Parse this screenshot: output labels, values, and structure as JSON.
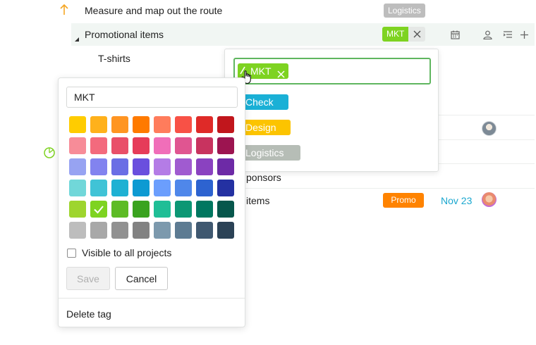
{
  "tasks": {
    "route": {
      "label": "Measure and map out the route",
      "tag": "Logistics"
    },
    "promo": {
      "label": "Promotional items",
      "tag": "MKT"
    },
    "tshirts": {
      "label": "T-shirts"
    },
    "sponsors": {
      "label": "ponsors"
    },
    "items": {
      "label": "items",
      "tag": "Promo",
      "due": "Nov 23"
    }
  },
  "tag_picker": {
    "selected_chip": "MKT",
    "options": [
      {
        "label": "Check",
        "color": "#1ab0d6"
      },
      {
        "label": "Design",
        "color": "#fcc400"
      },
      {
        "label": "Logistics",
        "color": "#b6bdb6"
      }
    ]
  },
  "edit_tag": {
    "name_value": "MKT",
    "visible_label": "Visible to all projects",
    "save_label": "Save",
    "cancel_label": "Cancel",
    "delete_label": "Delete tag",
    "selected_color": "#7ed321"
  },
  "colors": {
    "accent_green": "#5fb65f",
    "mkt": "#7ed321",
    "promo": "#ff8300",
    "logistics": "#bdbdbd",
    "date": "#1aa7cf",
    "palette": [
      [
        "#ffcc00",
        "#ffb11b",
        "#ff9522",
        "#ff7a00",
        "#ff7c5c",
        "#f85146",
        "#df2a28",
        "#c1161c"
      ],
      [
        "#f78c98",
        "#f36a7d",
        "#e94f69",
        "#e63c59",
        "#f06eb9",
        "#e05591",
        "#c8335f",
        "#9c1450"
      ],
      [
        "#97a3f2",
        "#8283ef",
        "#6a6ee5",
        "#6a4fde",
        "#b47ce6",
        "#a05bd0",
        "#8a42c0",
        "#6d2aa6"
      ],
      [
        "#71d7d9",
        "#40c3d6",
        "#1eb1d3",
        "#0d9ad2",
        "#6b9efd",
        "#4f87ea",
        "#2d63d0",
        "#2431a2"
      ],
      [
        "#9ed52e",
        "#7ed321",
        "#5dbb25",
        "#3aa31f",
        "#1fbe96",
        "#0c9774",
        "#007760",
        "#07574c"
      ],
      [
        "#bdbdbd",
        "#a8a8a8",
        "#919191",
        "#828282",
        "#7c99ad",
        "#5d7b92",
        "#3f5870",
        "#2b4256"
      ]
    ]
  }
}
